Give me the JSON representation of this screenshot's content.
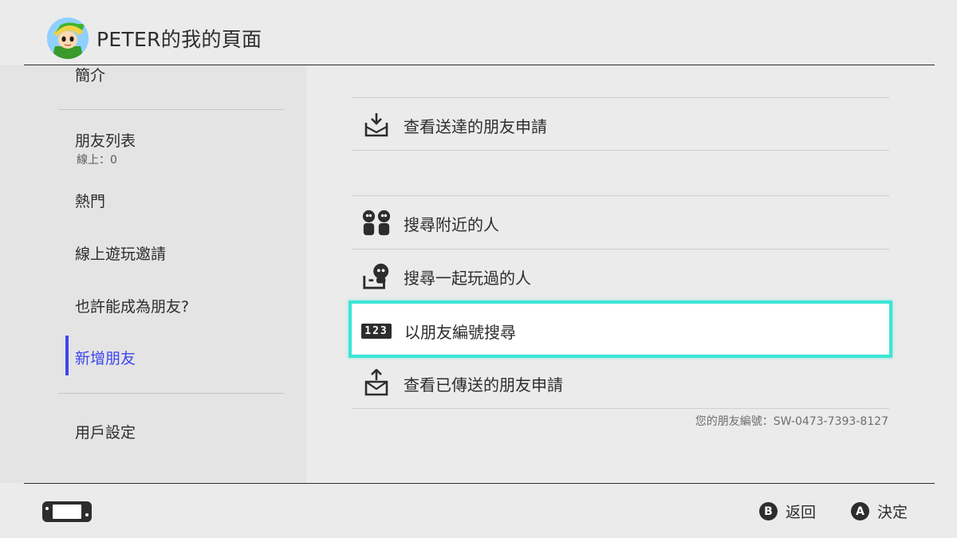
{
  "header": {
    "title": "PETER的我的頁面",
    "avatar_icon": "link-avatar-icon"
  },
  "sidebar": {
    "items": [
      {
        "label": "簡介"
      },
      {
        "label": "朋友列表",
        "sub": "線上：0"
      },
      {
        "label": "熱門"
      },
      {
        "label": "線上遊玩邀請"
      },
      {
        "label": "也許能成為朋友?"
      },
      {
        "label": "新增朋友",
        "active": true
      },
      {
        "label": "用戶設定"
      }
    ]
  },
  "main": {
    "rows": [
      {
        "label": "查看送達的朋友申請",
        "icon": "inbox-download-icon"
      },
      {
        "label": "搜尋附近的人",
        "icon": "nearby-people-icon"
      },
      {
        "label": "搜尋一起玩過的人",
        "icon": "played-with-icon"
      },
      {
        "label": "以朋友編號搜尋",
        "icon": "friend-code-123-icon",
        "selected": true
      },
      {
        "label": "查看已傳送的朋友申請",
        "icon": "outbox-upload-icon"
      }
    ],
    "code_badge": "123",
    "friend_code": "您的朋友編號：SW-0473-7393-8127"
  },
  "footer": {
    "console_icon": "switch-console-icon",
    "back": {
      "button": "B",
      "label": "返回"
    },
    "ok": {
      "button": "A",
      "label": "決定"
    }
  },
  "colors": {
    "accent": "#3c46ef",
    "selection": "#3ce5d5",
    "background": "#ebebeb",
    "sidebar": "#e4e4e4"
  }
}
